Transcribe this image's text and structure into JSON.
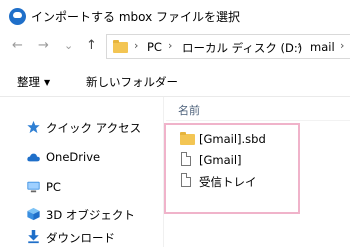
{
  "window": {
    "title": "インポートする mbox ファイルを選択"
  },
  "nav": {
    "back": "←",
    "forward": "→",
    "recent": "⌄",
    "up": "↑"
  },
  "address": {
    "crumbs": [
      "PC",
      "ローカル ディスク (D:)",
      "mail"
    ],
    "separators": [
      "›",
      "›",
      "›",
      "›"
    ]
  },
  "toolbar": {
    "organize_label": "整理",
    "organize_caret": "▼",
    "new_folder_label": "新しいフォルダー"
  },
  "sidebar": {
    "items": [
      {
        "label": "クイック アクセス",
        "icon": "star-icon"
      },
      {
        "label": "OneDrive",
        "icon": "cloud-icon"
      },
      {
        "label": "PC",
        "icon": "computer-icon"
      },
      {
        "label": "3D オブジェクト",
        "icon": "cube-icon"
      },
      {
        "label": "ダウンロード",
        "icon": "download-icon"
      }
    ]
  },
  "file_list": {
    "column_name": "名前",
    "files": [
      {
        "name": "[Gmail].sbd",
        "type": "folder"
      },
      {
        "name": "[Gmail]",
        "type": "file"
      },
      {
        "name": "受信トレイ",
        "type": "file"
      }
    ]
  },
  "colors": {
    "accent": "#1f6fc9",
    "highlight_border": "#f0b3ca",
    "folder": "#f3c553"
  }
}
